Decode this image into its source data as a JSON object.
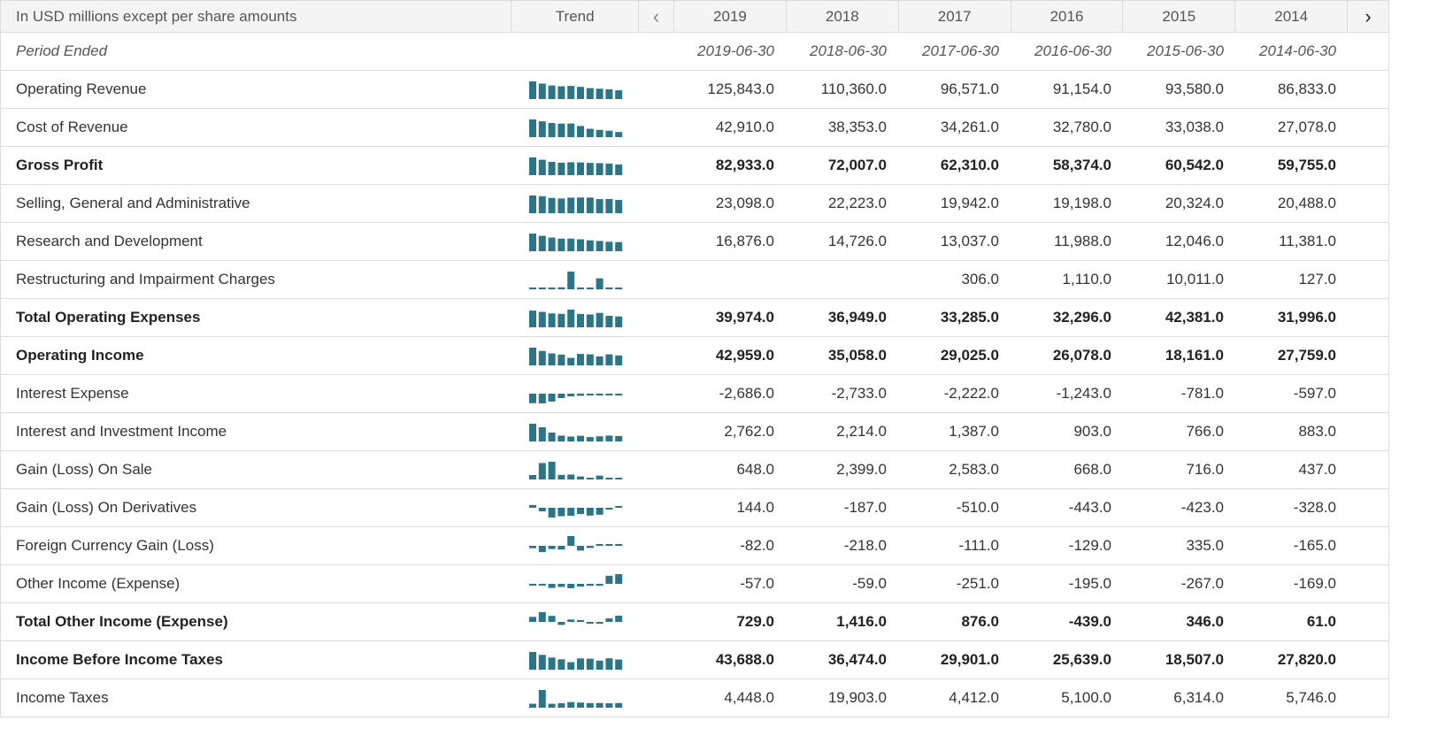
{
  "header": {
    "label": "In USD millions except per share amounts",
    "trend": "Trend",
    "prev": "‹",
    "next": "›",
    "years": [
      "2019",
      "2018",
      "2017",
      "2016",
      "2015",
      "2014"
    ]
  },
  "period": {
    "label": "Period Ended",
    "dates": [
      "2019-06-30",
      "2018-06-30",
      "2017-06-30",
      "2016-06-30",
      "2015-06-30",
      "2014-06-30"
    ]
  },
  "accent_color": "#2b7589",
  "rows": [
    {
      "name": "operating-revenue",
      "label": "Operating Revenue",
      "bold": false,
      "values": [
        "125,843.0",
        "110,360.0",
        "96,571.0",
        "91,154.0",
        "93,580.0",
        "86,833.0"
      ],
      "trend": [
        125843,
        110360,
        96571,
        91154,
        93580,
        86833,
        77849,
        73723,
        69943,
        62484
      ]
    },
    {
      "name": "cost-of-revenue",
      "label": "Cost of Revenue",
      "bold": false,
      "values": [
        "42,910.0",
        "38,353.0",
        "34,261.0",
        "32,780.0",
        "33,038.0",
        "27,078.0"
      ],
      "trend": [
        42910,
        38353,
        34261,
        32780,
        33038,
        27078,
        20249,
        17530,
        15577,
        12395
      ]
    },
    {
      "name": "gross-profit",
      "label": "Gross Profit",
      "bold": true,
      "values": [
        "82,933.0",
        "72,007.0",
        "62,310.0",
        "58,374.0",
        "60,542.0",
        "59,755.0"
      ],
      "trend": [
        82933,
        72007,
        62310,
        58374,
        60542,
        59755,
        57600,
        56193,
        54366,
        50089
      ]
    },
    {
      "name": "sga",
      "label": "Selling, General and Administrative",
      "bold": false,
      "values": [
        "23,098.0",
        "22,223.0",
        "19,942.0",
        "19,198.0",
        "20,324.0",
        "20,488.0"
      ],
      "trend": [
        23098,
        22223,
        19942,
        19198,
        20324,
        20488,
        20425,
        18426,
        18555,
        17262
      ]
    },
    {
      "name": "rnd",
      "label": "Research and Development",
      "bold": false,
      "values": [
        "16,876.0",
        "14,726.0",
        "13,037.0",
        "11,988.0",
        "12,046.0",
        "11,381.0"
      ],
      "trend": [
        16876,
        14726,
        13037,
        11988,
        12046,
        11381,
        10411,
        9811,
        9043,
        8714
      ]
    },
    {
      "name": "restructuring",
      "label": "Restructuring and Impairment Charges",
      "bold": false,
      "values": [
        "",
        "",
        "306.0",
        "1,110.0",
        "10,011.0",
        "127.0"
      ],
      "trend": [
        0,
        0,
        306,
        1110,
        10011,
        127,
        0,
        6193,
        0,
        0
      ]
    },
    {
      "name": "total-operating-expenses",
      "label": "Total Operating Expenses",
      "bold": true,
      "values": [
        "39,974.0",
        "36,949.0",
        "33,285.0",
        "32,296.0",
        "42,381.0",
        "31,996.0"
      ],
      "trend": [
        39974,
        36949,
        33285,
        32296,
        42381,
        31996,
        30836,
        34430,
        27598,
        25976
      ]
    },
    {
      "name": "operating-income",
      "label": "Operating Income",
      "bold": true,
      "values": [
        "42,959.0",
        "35,058.0",
        "29,025.0",
        "26,078.0",
        "18,161.0",
        "27,759.0"
      ],
      "trend": [
        42959,
        35058,
        29025,
        26078,
        18161,
        27759,
        26764,
        21763,
        26768,
        24113
      ]
    },
    {
      "name": "interest-expense",
      "label": "Interest Expense",
      "bold": false,
      "values": [
        "-2,686.0",
        "-2,733.0",
        "-2,222.0",
        "-1,243.0",
        "-781.0",
        "-597.0"
      ],
      "trend": [
        -2686,
        -2733,
        -2222,
        -1243,
        -781,
        -597,
        -429,
        -380,
        -295,
        -151
      ]
    },
    {
      "name": "interest-investment-income",
      "label": "Interest and Investment Income",
      "bold": false,
      "values": [
        "2,762.0",
        "2,214.0",
        "1,387.0",
        "903.0",
        "766.0",
        "883.0"
      ],
      "trend": [
        2762,
        2214,
        1387,
        903,
        766,
        883,
        677,
        800,
        910,
        843
      ]
    },
    {
      "name": "gain-on-sale",
      "label": "Gain (Loss) On Sale",
      "bold": false,
      "values": [
        "648.0",
        "2,399.0",
        "2,583.0",
        "668.0",
        "716.0",
        "437.0"
      ],
      "trend": [
        648,
        2399,
        2583,
        668,
        716,
        437,
        116,
        564,
        0,
        0
      ]
    },
    {
      "name": "gain-on-derivatives",
      "label": "Gain (Loss) On Derivatives",
      "bold": false,
      "values": [
        "144.0",
        "-187.0",
        "-510.0",
        "-443.0",
        "-423.0",
        "-328.0"
      ],
      "trend": [
        144,
        -187,
        -510,
        -443,
        -423,
        -328,
        -411,
        -364,
        -77,
        0
      ]
    },
    {
      "name": "fx-gain",
      "label": "Foreign Currency Gain (Loss)",
      "bold": false,
      "values": [
        "-82.0",
        "-218.0",
        "-111.0",
        "-129.0",
        "335.0",
        "-165.0"
      ],
      "trend": [
        -82,
        -218,
        -111,
        -129,
        335,
        -165,
        -74,
        0,
        0,
        0
      ]
    },
    {
      "name": "other-income",
      "label": "Other Income (Expense)",
      "bold": false,
      "values": [
        "-57.0",
        "-59.0",
        "-251.0",
        "-195.0",
        "-267.0",
        "-169.0"
      ],
      "trend": [
        -57,
        -59,
        -251,
        -195,
        -267,
        -169,
        -118,
        -120,
        500,
        600
      ]
    },
    {
      "name": "total-other-income",
      "label": "Total Other Income (Expense)",
      "bold": true,
      "values": [
        "729.0",
        "1,416.0",
        "876.0",
        "-439.0",
        "346.0",
        "61.0"
      ],
      "trend": [
        729,
        1416,
        876,
        -439,
        346,
        61,
        -20,
        -30,
        504,
        910
      ]
    },
    {
      "name": "income-before-taxes",
      "label": "Income Before Income Taxes",
      "bold": true,
      "values": [
        "43,688.0",
        "36,474.0",
        "29,901.0",
        "25,639.0",
        "18,507.0",
        "27,820.0"
      ],
      "trend": [
        43688,
        36474,
        29901,
        25639,
        18507,
        27820,
        27052,
        22267,
        28071,
        25013
      ]
    },
    {
      "name": "income-taxes",
      "label": "Income Taxes",
      "bold": false,
      "values": [
        "4,448.0",
        "19,903.0",
        "4,412.0",
        "5,100.0",
        "6,314.0",
        "5,746.0"
      ],
      "trend": [
        4448,
        19903,
        4412,
        5100,
        6314,
        5746,
        5189,
        5289,
        4921,
        5254
      ]
    }
  ]
}
